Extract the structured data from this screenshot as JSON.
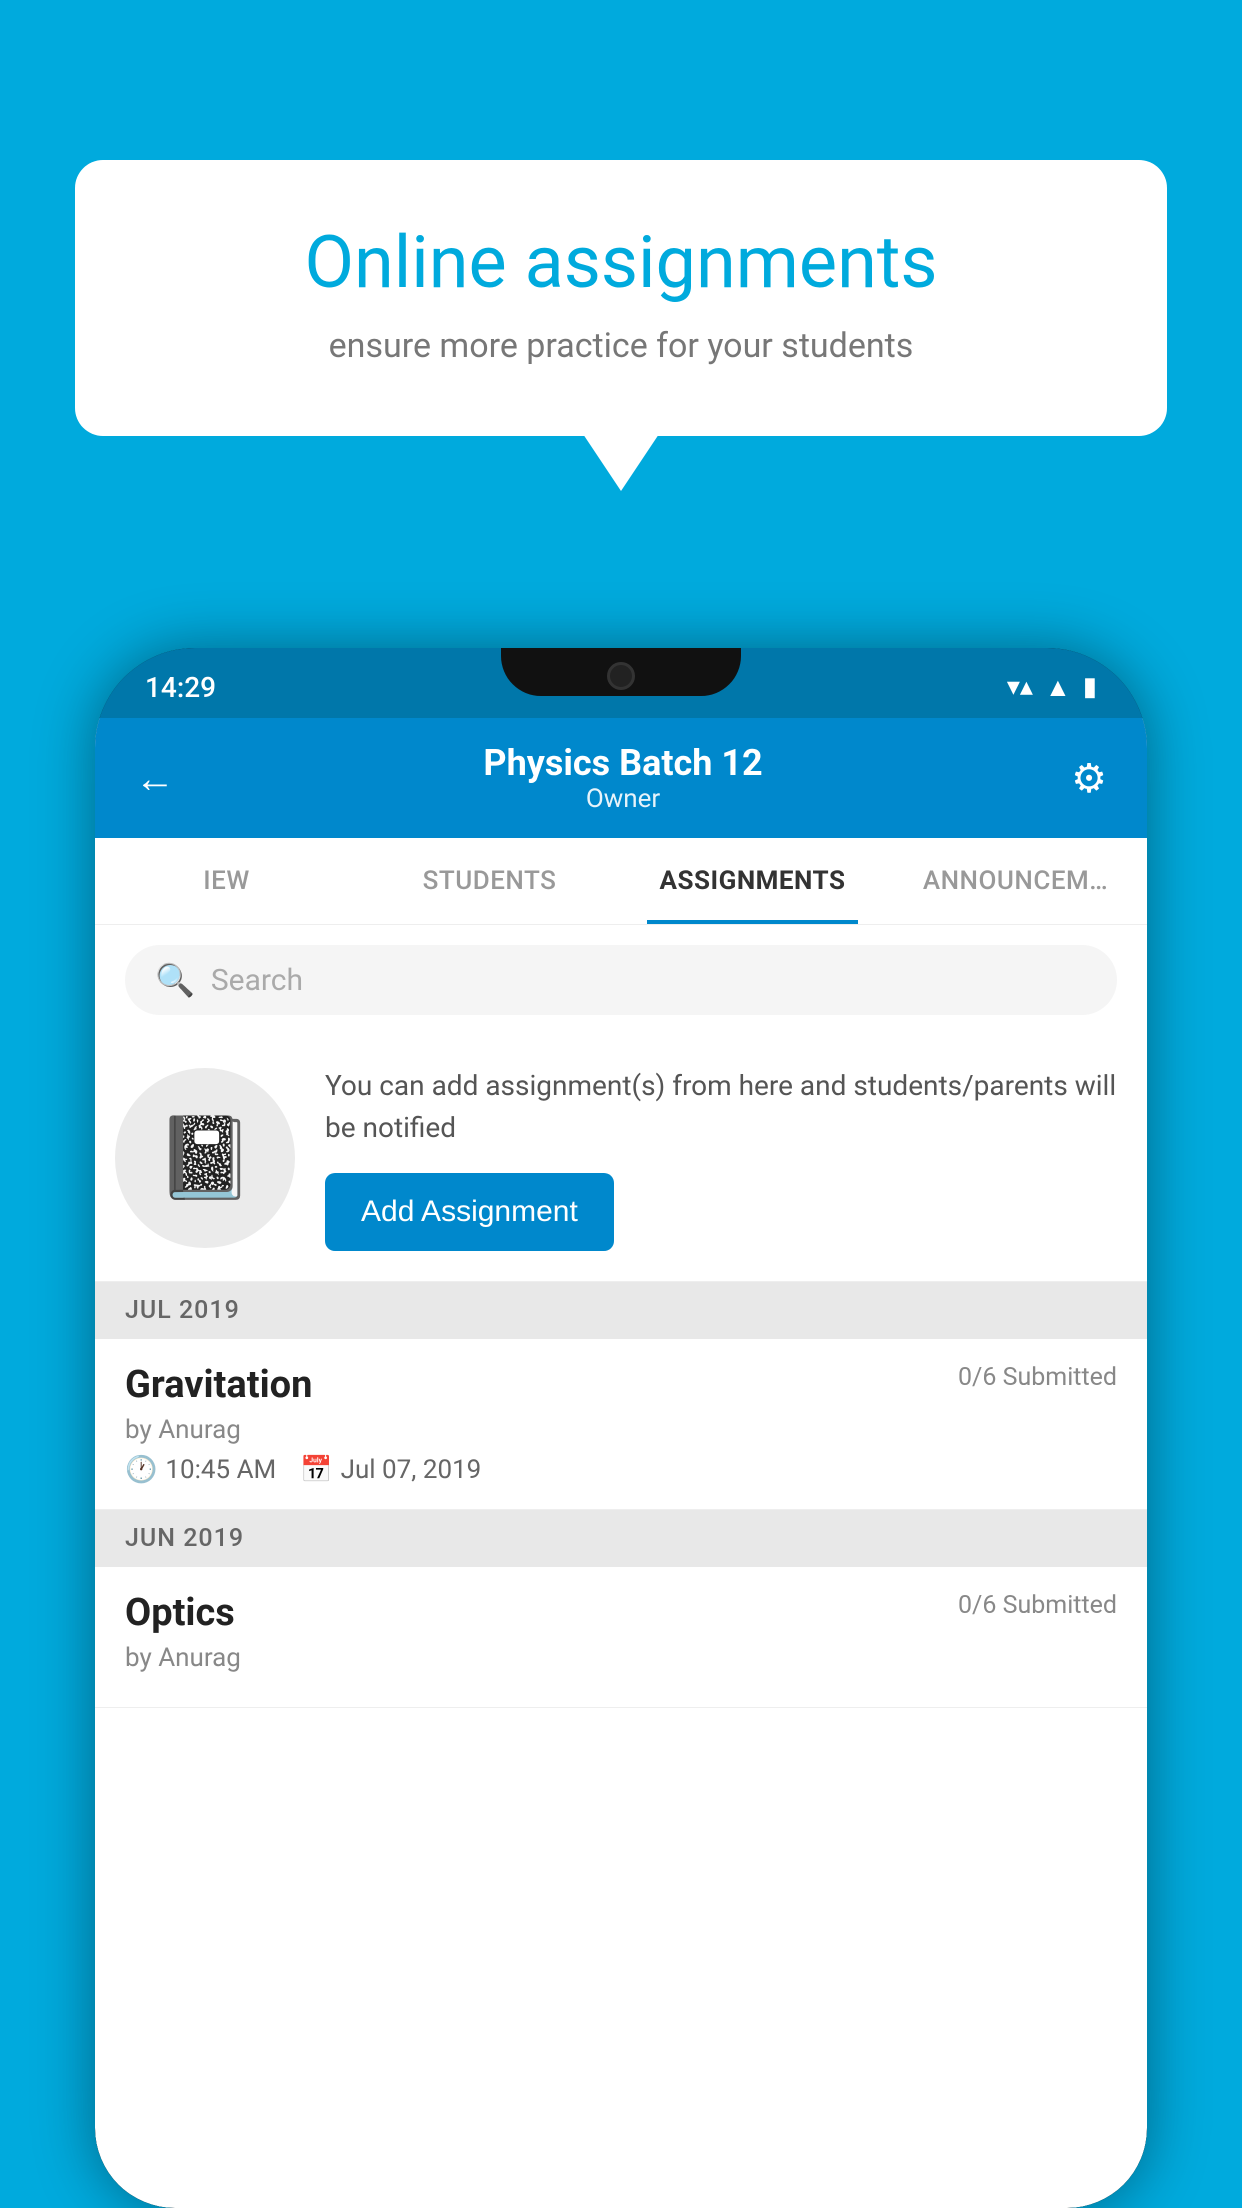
{
  "background_color": "#00AADD",
  "speech_bubble": {
    "title": "Online assignments",
    "subtitle": "ensure more practice for your students"
  },
  "phone": {
    "status_bar": {
      "time": "14:29",
      "wifi_icon": "▼",
      "signal_icon": "▲",
      "battery_icon": "▮"
    },
    "header": {
      "title": "Physics Batch 12",
      "subtitle": "Owner",
      "back_label": "←",
      "gear_label": "⚙"
    },
    "tabs": [
      {
        "label": "IEW",
        "active": false
      },
      {
        "label": "STUDENTS",
        "active": false
      },
      {
        "label": "ASSIGNMENTS",
        "active": true
      },
      {
        "label": "ANNOUNCEM…",
        "active": false
      }
    ],
    "search": {
      "placeholder": "Search"
    },
    "empty_state": {
      "description": "You can add assignment(s) from here and students/parents will be notified",
      "button_label": "Add Assignment"
    },
    "month_sections": [
      {
        "label": "JUL 2019",
        "assignments": [
          {
            "name": "Gravitation",
            "submitted": "0/6 Submitted",
            "by": "by Anurag",
            "time": "10:45 AM",
            "date": "Jul 07, 2019"
          }
        ]
      },
      {
        "label": "JUN 2019",
        "assignments": [
          {
            "name": "Optics",
            "submitted": "0/6 Submitted",
            "by": "by Anurag",
            "time": "",
            "date": ""
          }
        ]
      }
    ]
  }
}
